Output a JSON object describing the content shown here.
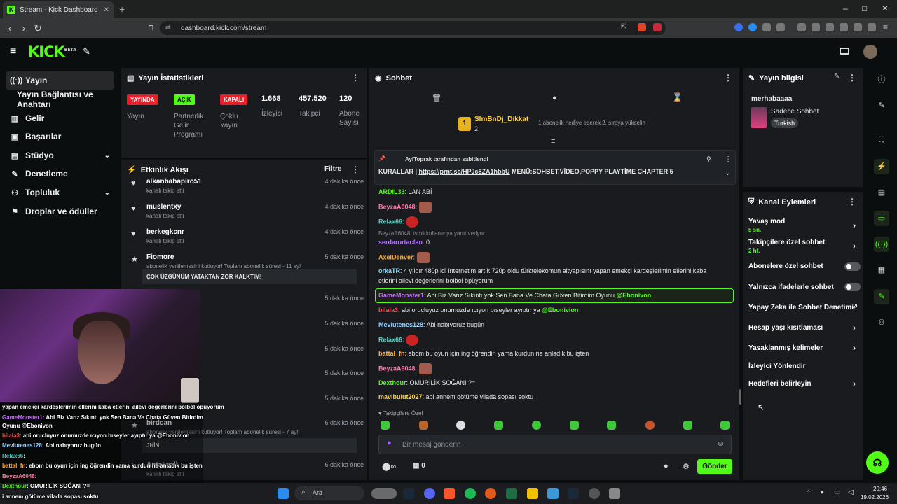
{
  "browser": {
    "tab_title": "Stream - Kick Dashboard",
    "url": "dashboard.kick.com/stream"
  },
  "brand": {
    "logo": "KICK",
    "beta": "BETA",
    "accent": "#53fc18"
  },
  "sidebar": {
    "items": [
      {
        "label": "Yayın",
        "icon": "broadcast-icon"
      },
      {
        "label": "Yayın Bağlantısı ve Anahtarı"
      },
      {
        "label": "Gelir",
        "icon": "chart-icon"
      },
      {
        "label": "Başarılar",
        "icon": "trophy-icon"
      },
      {
        "label": "Stüdyo",
        "icon": "studio-icon"
      },
      {
        "label": "Denetleme",
        "icon": "wrench-icon"
      },
      {
        "label": "Topluluk",
        "icon": "people-icon"
      },
      {
        "label": "Droplar ve ödüller",
        "icon": "gift-icon"
      }
    ]
  },
  "stats": {
    "title": "Yayın İstatistikleri",
    "badges": [
      {
        "label": "YAYINDA",
        "sub": "Yayın"
      },
      {
        "label": "AÇIK",
        "sub": "Partnerlik Gelir Programı"
      },
      {
        "label": "KAPALI",
        "sub": "Çoklu Yayın"
      }
    ],
    "numbers": [
      {
        "value": "1.668",
        "label": "İzleyici"
      },
      {
        "value": "457.520",
        "label": "Takipçi"
      },
      {
        "value": "120",
        "label": "Abone Sayısı"
      }
    ]
  },
  "activity": {
    "title": "Etkinlik Akışı",
    "filter": "Filtre",
    "items": [
      {
        "name": "alkanbabapiro51",
        "sub": "kanalı takip etti",
        "time": "4 dakika önce"
      },
      {
        "name": "muslentxy",
        "sub": "kanalı takip etti",
        "time": "4 dakika önce"
      },
      {
        "name": "berkegkcnr",
        "sub": "kanalı takip etti",
        "time": "4 dakika önce"
      },
      {
        "name": "Fiomore",
        "sub": "abonelik yenilemesini kutluyor! Toplam abonelik süresi - 11 ay!",
        "time": "5 dakika önce",
        "msg": "ÇOK ÜZGÜNÜM YATAKTAN ZOR KALKTIM!"
      },
      {
        "time": "5 dakika önce"
      },
      {
        "time": "5 dakika önce"
      },
      {
        "time": "5 dakika önce"
      },
      {
        "time": "5 dakika önce"
      },
      {
        "time": "5 dakika önce"
      },
      {
        "name": "birdcan",
        "sub": "abonelik yenilemesini kutluyor! Toplam abonelik süresi - 7 ay!",
        "time": "6 dakika önce",
        "msg": "JHİN"
      },
      {
        "name": "Antakyali",
        "sub": "kanalı takip etti",
        "time": "6 dakika önce"
      }
    ]
  },
  "chat": {
    "title": "Sohbet",
    "top_gifter": {
      "name": "SlmBnDj_Dikkat",
      "count": "2",
      "rank": "1",
      "hint": "1 abonelik hediye ederek 2. sıraya yükselin"
    },
    "pinned": {
      "by": "AyiToprak tarafından sabitlendi",
      "prefix": "KURALLAR |",
      "link": "https://prnt.sc/HPJc8ZA1hbbU",
      "rest": "MENÜ:SOHBET,VİDEO,POPPY PLAYTİME CHAPTER 5"
    },
    "messages": [
      {
        "user": "ARDIL33",
        "text": "LAN ABİ",
        "color": "#53fc18"
      },
      {
        "user": "BeyzaA6048",
        "text": "",
        "color": "#ff7aa8",
        "emote": true
      },
      {
        "user": "Relax66",
        "text": "",
        "color": "#4fd1c5",
        "emote2": true
      },
      {
        "user": "serdarortacfan",
        "text": "0",
        "color": "#b57cff",
        "reply": "BeyzaA6048: ismli kullanıcıya yanıt veriyor"
      },
      {
        "user": "AxelDenver",
        "text": "",
        "color": "#ffb13b",
        "emote": true
      },
      {
        "user": "orkaTR",
        "text": "4 yıldır 480p idi internetim artık 720p oldu türktelekomun altyapısını yapan emekçi kardeşlerimin ellerini kaba",
        "text2": "etlerini ailevi değerlerini bolbol öpüyorum",
        "color": "#7ee0ff"
      },
      {
        "user": "GameMonster1",
        "text": "Abi Biz Varız Sıkıntı yok Sen Bana Ve Chata Güven Bitirdim Oyunu",
        "mention": "@Ebonivon",
        "color": "#c86bff",
        "highlight": true
      },
      {
        "user": "bilala3",
        "text": "abi orucluyuz onumuzde ıcıyon bıseyler ayıptır ya",
        "mention": "@Ebonivion",
        "color": "#ff4d4d"
      },
      {
        "user": "Mevlutenes128",
        "text": "Abi nabıyoruz bugün",
        "color": "#9ad0ff"
      },
      {
        "user": "Relax66",
        "text": "",
        "color": "#4fd1c5",
        "emote2": true
      },
      {
        "user": "battal_fn",
        "text": "ebom bu oyun için ing öğrendin yama kurdun ne anladık bu işten",
        "color": "#ffb13b"
      },
      {
        "user": "BeyzaA6048",
        "text": "",
        "color": "#ff7aa8",
        "emote": true
      },
      {
        "user": "Dexthour",
        "text": "OMURİLİK SOĞANI ?=",
        "color": "#53fc18"
      },
      {
        "user": "mavibulut2027",
        "text": "abi annem götüme vilada sopası soktu",
        "color": "#ffd23f"
      }
    ],
    "followers_only": "Takipçilere Özel",
    "input_placeholder": "Bir mesaj gönderin",
    "points": "∞",
    "gifts": "0",
    "send": "Gönder"
  },
  "stream_info": {
    "title": "Yayın bilgisi",
    "stream_title": "merhabaaaa",
    "category": "Sadece Sohbet",
    "tag": "Turkish"
  },
  "channel_actions": {
    "title": "Kanal Eylemleri",
    "items": [
      {
        "label": "Yavaş mod",
        "sub": "5 sn.",
        "control": "chevron"
      },
      {
        "label": "Takipçilere özel sohbet",
        "sub": "2 hf.",
        "control": "chevron"
      },
      {
        "label": "Abonelere özel sohbet",
        "control": "toggle"
      },
      {
        "label": "Yalnızca ifadelerle sohbet",
        "control": "toggle"
      },
      {
        "label": "Yapay Zeka ile Sohbet Denetimi",
        "control": "external"
      },
      {
        "label": "Hesap yaşı kısıtlaması",
        "control": "chevron"
      },
      {
        "label": "Yasaklanmış kelimeler",
        "control": "chevron"
      },
      {
        "label": "İzleyici Yönlendir",
        "control": "none"
      },
      {
        "label": "Hedefleri belirleyin",
        "control": "chevron"
      }
    ]
  },
  "overlay_chat": [
    {
      "user": "",
      "text": "yapan emekçi kardeşlerimin ellerini kaba etlerini ailevi değerlerini bolbol öpüyorum"
    },
    {
      "user": "GameMonster1",
      "text": ": Abi Biz Varız Sıkıntı yok Sen Bana Ve Chata Güven Bitirdim"
    },
    {
      "user": "",
      "text": "Oyunu @Ebonivon"
    },
    {
      "user": "bilala3",
      "text": ": abi orucluyuz onumuzde ıcıyon bıseyler ayıptır ya @Ebonivion"
    },
    {
      "user": "Mevlutenes128",
      "text": ": Abi nabıyoruz bugün"
    },
    {
      "user": "Relax66",
      "text": ":"
    },
    {
      "user": "battal_fn",
      "text": ": ebom bu oyun için ing öğrendin yama kurdun ne anladık bu işten"
    },
    {
      "user": "BeyzaA6048",
      "text": ":"
    },
    {
      "user": "Dexthour",
      "text": ": OMURİLİK SOĞANI ?="
    },
    {
      "user": "",
      "text": "i annem götüme vilada sopası soktu"
    }
  ],
  "taskbar": {
    "search": "Ara",
    "time": "20:46",
    "date": "19.02.2026"
  }
}
